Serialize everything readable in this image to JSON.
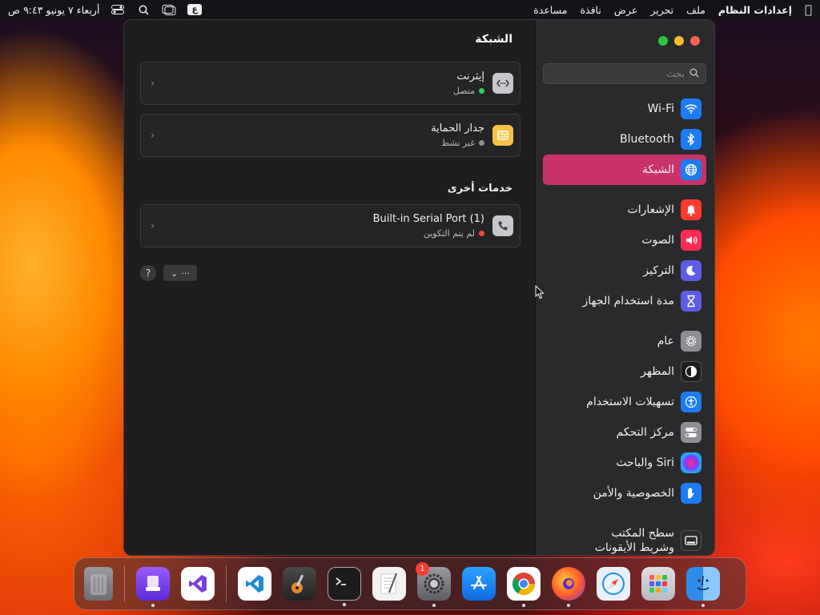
{
  "menubar": {
    "app_name": "إعدادات النظام",
    "menus": [
      "ملف",
      "تحرير",
      "عرض",
      "نافذة",
      "مساعدة"
    ],
    "input_source": "ع",
    "clock": "أربعاء ٧ يونيو ٩:٤٣ ص"
  },
  "sidebar": {
    "search_placeholder": "بحث",
    "items": [
      {
        "label": "Wi-Fi",
        "icon": "wifi-icon",
        "color": "#1d7cf2"
      },
      {
        "label": "Bluetooth",
        "icon": "bluetooth-icon",
        "color": "#1d7cf2"
      },
      {
        "label": "الشبكة",
        "icon": "globe-icon",
        "color": "#1d7cf2"
      },
      {
        "label": "الإشعارات",
        "icon": "bell-icon",
        "color": "#ff3b30"
      },
      {
        "label": "الصوت",
        "icon": "speaker-icon",
        "color": "#ff2d55"
      },
      {
        "label": "التركيز",
        "icon": "moon-icon",
        "color": "#5e5ce6"
      },
      {
        "label": "مدة استخدام الجهاز",
        "icon": "hourglass-icon",
        "color": "#5e5ce6"
      },
      {
        "label": "عام",
        "icon": "gear-icon",
        "color": "#8e8e93"
      },
      {
        "label": "المظهر",
        "icon": "appearance-icon",
        "color": "#1c1c1e"
      },
      {
        "label": "تسهيلات الاستخدام",
        "icon": "accessibility-icon",
        "color": "#1d7cf2"
      },
      {
        "label": "مركز التحكم",
        "icon": "toggles-icon",
        "color": "#8e8e93"
      },
      {
        "label": "Siri والباحث",
        "icon": "siri-icon",
        "color": "#222"
      },
      {
        "label": "الخصوصية والأمن",
        "icon": "hand-icon",
        "color": "#1d7cf2"
      },
      {
        "label": "سطح المكتب\nوشريط الأيقونات",
        "icon": "dock-icon",
        "color": "#2c2c2e"
      }
    ],
    "active_index": 2
  },
  "content": {
    "title": "الشبكة",
    "services": [
      {
        "title": "إيثرنت",
        "status": "متصل",
        "status_color": "#30d158",
        "icon": "ethernet-icon",
        "icon_color": "#c7c7cc"
      },
      {
        "title": "جدار الحماية",
        "status": "غير نشط",
        "status_color": "#8e8e93",
        "icon": "firewall-icon",
        "icon_color": "#f5c242"
      }
    ],
    "other_services_label": "خدمات أخرى",
    "other_services": [
      {
        "title": "Built-in Serial Port (1)",
        "status": "لم يتم التكوين",
        "status_color": "#ff453a",
        "icon": "phone-icon",
        "icon_color": "#c7c7cc"
      }
    ],
    "more_button": "···",
    "help_button": "?"
  },
  "dock": {
    "notification_badge": "1",
    "items": [
      {
        "name": "finder-icon",
        "color": "#2f8ce6",
        "running": true
      },
      {
        "name": "launchpad-icon",
        "color": "#d0d0d4",
        "running": false
      },
      {
        "name": "safari-icon",
        "color": "#e8f1fb",
        "running": false
      },
      {
        "name": "firefox-icon",
        "color": "#4a2a8a",
        "running": true
      },
      {
        "name": "chrome-icon",
        "color": "#ffffff",
        "running": true
      },
      {
        "name": "app-store-icon",
        "color": "#1a8cf0",
        "running": false
      },
      {
        "name": "system-settings-icon",
        "color": "#8e8e93",
        "running": true
      },
      {
        "name": "textedit-icon",
        "color": "#f2f2f2",
        "running": false
      },
      {
        "name": "terminal-icon",
        "color": "#1c1c1e",
        "running": true
      },
      {
        "name": "garageband-icon",
        "color": "#3a3a3a",
        "running": false
      },
      {
        "name": "vscode-icon",
        "color": "#ffffff",
        "running": false
      },
      {
        "name": "visual-studio-icon",
        "color": "#ffffff",
        "running": false
      },
      {
        "name": "simulator-icon",
        "color": "#7d3ff2",
        "running": true
      },
      {
        "name": "trash-icon",
        "color": "#8e8e93",
        "running": false
      }
    ]
  }
}
